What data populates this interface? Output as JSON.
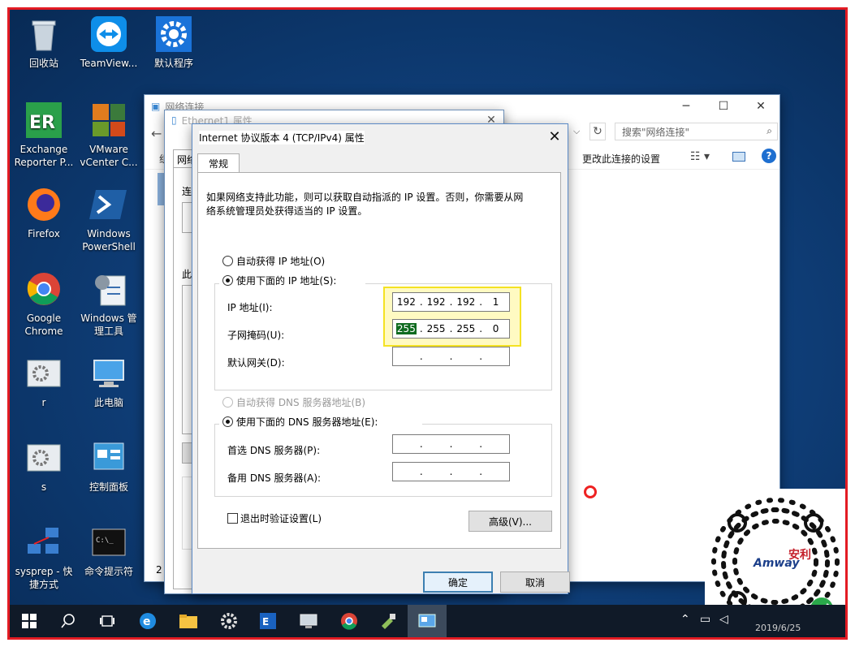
{
  "desktop_icons": [
    {
      "label": "回收站",
      "icon": "recycle-bin-icon"
    },
    {
      "label": "TeamView...",
      "icon": "teamviewer-icon"
    },
    {
      "label": "默认程序",
      "icon": "gear-icon"
    },
    {
      "label": "Exchange\nReporter P...",
      "icon": "exchange-reporter-icon"
    },
    {
      "label": "VMware\nvCenter C...",
      "icon": "vmware-icon"
    },
    {
      "label": "Firefox",
      "icon": "firefox-icon"
    },
    {
      "label": "Windows\nPowerShell",
      "icon": "powershell-icon"
    },
    {
      "label": "Google\nChrome",
      "icon": "chrome-icon"
    },
    {
      "label": "Windows 管\n理工具",
      "icon": "admin-tools-icon"
    },
    {
      "label": "r",
      "icon": "settings-file-icon"
    },
    {
      "label": "此电脑",
      "icon": "this-pc-icon"
    },
    {
      "label": "s",
      "icon": "settings-file-icon"
    },
    {
      "label": "控制面板",
      "icon": "control-panel-icon"
    },
    {
      "label": "sysprep - 快\n捷方式",
      "icon": "sysprep-icon"
    },
    {
      "label": "命令提示符",
      "icon": "cmd-icon"
    }
  ],
  "net_window": {
    "title": "网络连接",
    "search_placeholder": "搜索\"网络连接\"",
    "toolbar_change": "更改此连接的设置",
    "tab_partial": "网络",
    "left_partial_1": "连",
    "left_partial_2": "此",
    "left_partial_3": "2"
  },
  "eth_window": {
    "title": "Ethernet1 属性"
  },
  "dialog": {
    "title": "Internet 协议版本 4 (TCP/IPv4) 属性",
    "tab": "常规",
    "intro_1": "如果网络支持此功能，则可以获取自动指派的 IP 设置。否则，你需要从网",
    "intro_2": "络系统管理员处获得适当的 IP 设置。",
    "auto_ip": "自动获得 IP 地址(O)",
    "use_ip": "使用下面的 IP 地址(S):",
    "ip_label": "IP 地址(I):",
    "ip_value": [
      "192",
      "192",
      "192",
      "1"
    ],
    "mask_label": "子网掩码(U):",
    "mask_value": [
      "255",
      "255",
      "255",
      "0"
    ],
    "gateway_label": "默认网关(D):",
    "auto_dns": "自动获得 DNS 服务器地址(B)",
    "use_dns": "使用下面的 DNS 服务器地址(E):",
    "dns1_label": "首选 DNS 服务器(P):",
    "dns2_label": "备用 DNS 服务器(A):",
    "validate": "退出时验证设置(L)",
    "advanced": "高级(V)...",
    "ok": "确定",
    "cancel": "取消"
  },
  "taskbar": {
    "icons": [
      "windows-start-icon",
      "search-icon",
      "task-view-icon",
      "edge-icon",
      "file-explorer-icon",
      "settings-gear-icon",
      "exchange-icon",
      "remote-desktop-icon",
      "chrome-icon",
      "tools-icon",
      "network-connections-icon"
    ],
    "tray_icons": [
      "chevron-up-icon",
      "network-tray-icon",
      "volume-icon"
    ],
    "clock_partial": "2019/6/25"
  },
  "watermark": {
    "brand": "Amway",
    "brand_cn": "安利"
  }
}
